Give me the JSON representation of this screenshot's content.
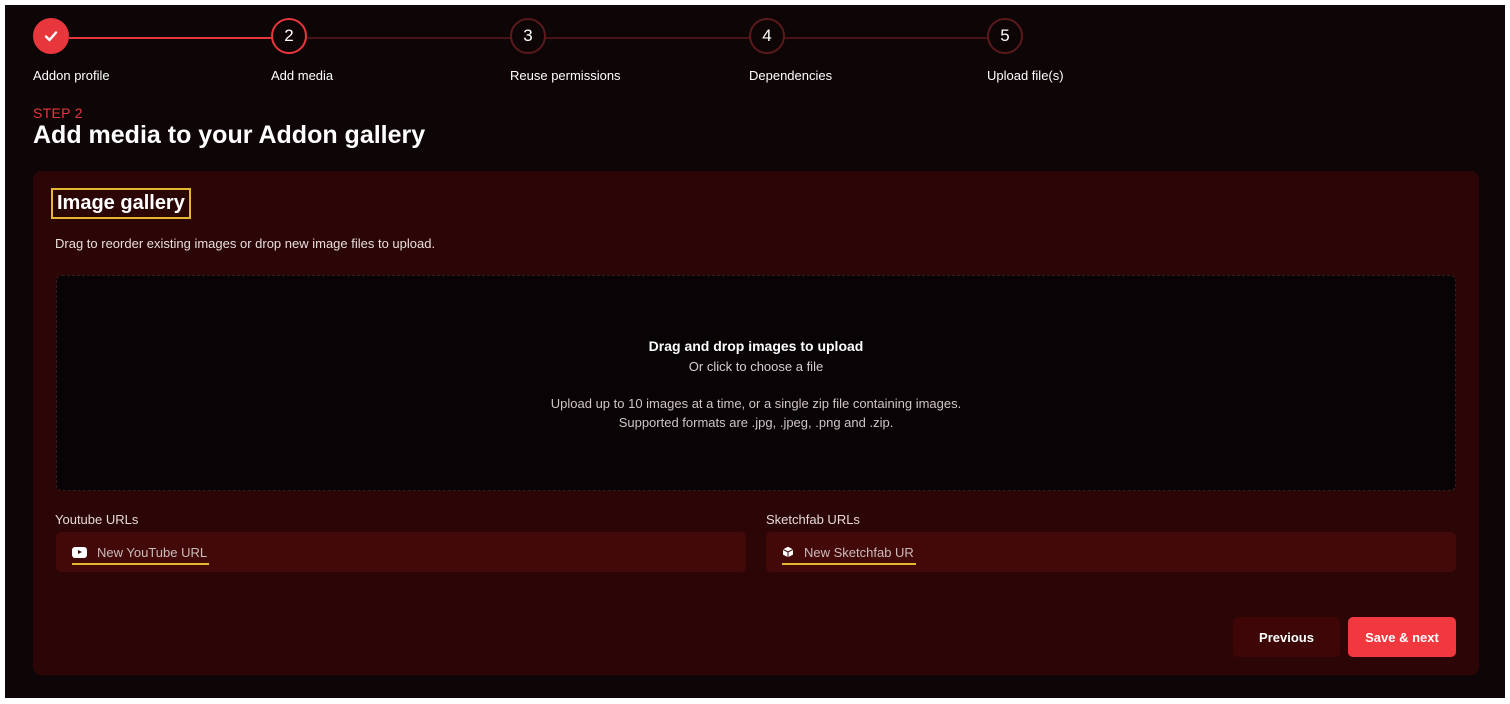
{
  "stepper": {
    "steps": [
      {
        "label": "Addon profile",
        "number": "",
        "state": "done"
      },
      {
        "label": "Add media",
        "number": "2",
        "state": "active"
      },
      {
        "label": "Reuse permissions",
        "number": "3",
        "state": "pending"
      },
      {
        "label": "Dependencies",
        "number": "4",
        "state": "pending"
      },
      {
        "label": "Upload file(s)",
        "number": "5",
        "state": "pending"
      }
    ]
  },
  "header": {
    "kicker": "STEP 2",
    "title": "Add media to your Addon gallery"
  },
  "gallery": {
    "title": "Image gallery",
    "description": "Drag to reorder existing images or drop new image files to upload.",
    "dropzone": {
      "title": "Drag and drop images to upload",
      "subtitle": "Or click to choose a file",
      "info_line1": "Upload up to 10 images at a time, or a single zip file containing images.",
      "info_line2": "Supported formats are .jpg, .jpeg, .png and .zip."
    }
  },
  "youtube": {
    "label": "Youtube URLs",
    "placeholder": "New YouTube URL"
  },
  "sketchfab": {
    "label": "Sketchfab URLs",
    "placeholder": "New Sketchfab URL"
  },
  "actions": {
    "previous_label": "Previous",
    "next_label": "Save & next"
  },
  "colors": {
    "accent": "#e8373c",
    "background": "#0e0506",
    "card": "#2c0606",
    "highlight": "#e6b830"
  }
}
